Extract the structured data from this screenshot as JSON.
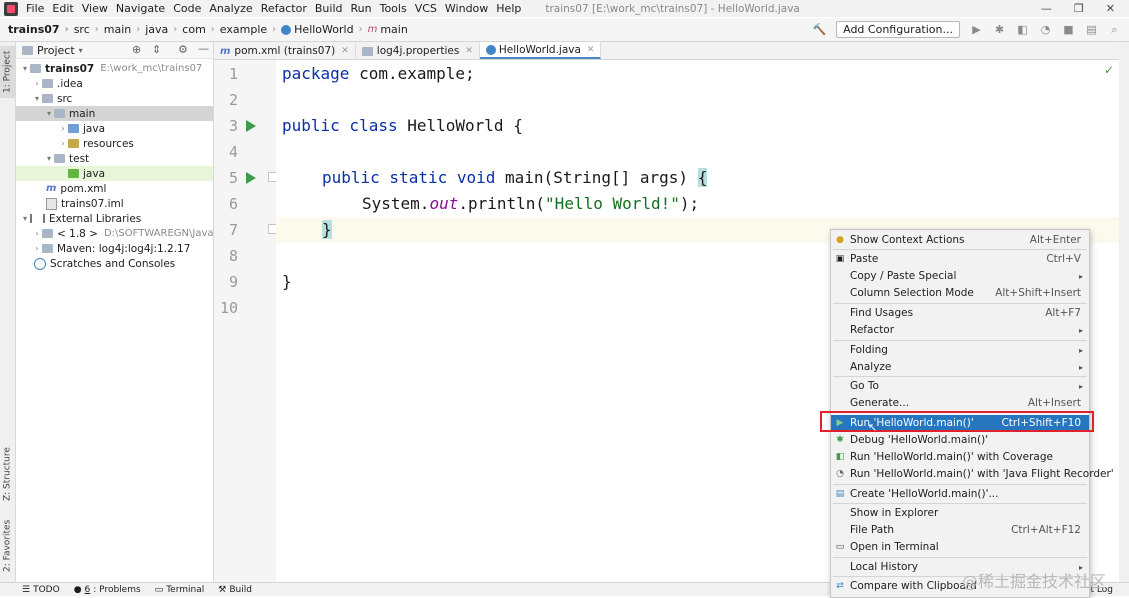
{
  "menubar": {
    "items": [
      "File",
      "Edit",
      "View",
      "Navigate",
      "Code",
      "Analyze",
      "Refactor",
      "Build",
      "Run",
      "Tools",
      "VCS",
      "Window",
      "Help"
    ],
    "window_title": "trains07 [E:\\work_mc\\trains07] - HelloWorld.java"
  },
  "navbar": {
    "crumbs": [
      "trains07",
      "src",
      "main",
      "java",
      "com",
      "example",
      "HelloWorld",
      "main"
    ],
    "add_config": "Add Configuration..."
  },
  "left_stripe": {
    "project": "1: Project",
    "structure": "Z: Structure",
    "favorites": "2: Favorites"
  },
  "project": {
    "header": "Project",
    "rows": [
      {
        "label": "trains07",
        "path": "E:\\work_mc\\trains07"
      },
      {
        "label": ".idea"
      },
      {
        "label": "src"
      },
      {
        "label": "main"
      },
      {
        "label": "java"
      },
      {
        "label": "resources"
      },
      {
        "label": "test"
      },
      {
        "label": "java"
      },
      {
        "label": "pom.xml"
      },
      {
        "label": "trains07.iml"
      },
      {
        "label": "External Libraries"
      },
      {
        "label": "< 1.8 >",
        "path": "D:\\SOFTWAREGN\\Java\\jd"
      },
      {
        "label": "Maven: log4j:log4j:1.2.17"
      },
      {
        "label": "Scratches and Consoles"
      }
    ]
  },
  "tabs": [
    "pom.xml (trains07)",
    "log4j.properties",
    "HelloWorld.java"
  ],
  "editor": {
    "line_numbers": [
      "1",
      "2",
      "3",
      "4",
      "5",
      "6",
      "7",
      "8",
      "9",
      "10"
    ],
    "kw_package": "package",
    "pkg_rest": " com.example;",
    "kw_public_class": "public class",
    "class_rest": " HelloWorld {",
    "kw_psv": "public static void",
    "main_rest": " main(String[] args) ",
    "brace_open": "{",
    "sys": "System.",
    "out": "out",
    "println": ".println(",
    "hello": "\"Hello World!\"",
    "end_call": ");",
    "brace_close": "}",
    "class_close": "}"
  },
  "statusbar": {
    "todo": "TODO",
    "problems_num": "6",
    "problems": ": Problems",
    "terminal": "Terminal",
    "build": "Build",
    "event_log": "nt Log"
  },
  "context_menu": {
    "items": [
      {
        "label": "Show Context Actions",
        "shortcut": "Alt+Enter"
      },
      {
        "label": "Paste",
        "shortcut": "Ctrl+V"
      },
      {
        "label": "Copy / Paste Special",
        "shortcut": ""
      },
      {
        "label": "Column Selection Mode",
        "shortcut": "Alt+Shift+Insert"
      },
      {
        "label": "Find Usages",
        "shortcut": "Alt+F7"
      },
      {
        "label": "Refactor",
        "shortcut": ""
      },
      {
        "label": "Folding",
        "shortcut": ""
      },
      {
        "label": "Analyze",
        "shortcut": ""
      },
      {
        "label": "Go To",
        "shortcut": ""
      },
      {
        "label": "Generate...",
        "shortcut": "Alt+Insert"
      },
      {
        "label": "Run 'HelloWorld.main()'",
        "shortcut": "Ctrl+Shift+F10"
      },
      {
        "label": "Debug 'HelloWorld.main()'",
        "shortcut": ""
      },
      {
        "label": "Run 'HelloWorld.main()' with Coverage",
        "shortcut": ""
      },
      {
        "label": "Run 'HelloWorld.main()' with 'Java Flight Recorder'",
        "shortcut": ""
      },
      {
        "label": "Create 'HelloWorld.main()'...",
        "shortcut": ""
      },
      {
        "label": "Show in Explorer",
        "shortcut": ""
      },
      {
        "label": "File Path",
        "shortcut": "Ctrl+Alt+F12"
      },
      {
        "label": "Open in Terminal",
        "shortcut": ""
      },
      {
        "label": "Local History",
        "shortcut": ""
      },
      {
        "label": "Compare with Clipboard",
        "shortcut": ""
      }
    ]
  },
  "watermark": "@稀土掘金技术社区",
  "colors": {
    "accent": "#2675bf",
    "run_green": "#3e9c48",
    "highlight_box": "#e0202a"
  }
}
